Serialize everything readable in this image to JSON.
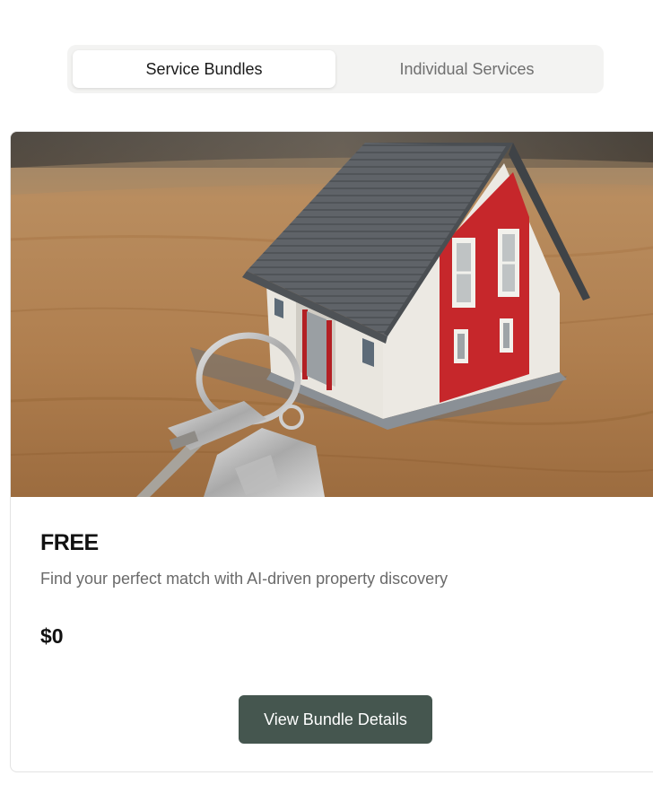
{
  "tabs": [
    {
      "label": "Service Bundles",
      "active": true
    },
    {
      "label": "Individual Services",
      "active": false
    }
  ],
  "bundle": {
    "image_alt": "Model house with keys on a wooden table",
    "title": "FREE",
    "description": "Find your perfect match with AI-driven property discovery",
    "price": "$0",
    "cta_label": "View Bundle Details"
  },
  "colors": {
    "accent": "#45564f",
    "tab_bg": "#f3f3f2",
    "roof": "#6a6e72",
    "red_wall": "#c8272b",
    "wood": "#b88a5c"
  }
}
